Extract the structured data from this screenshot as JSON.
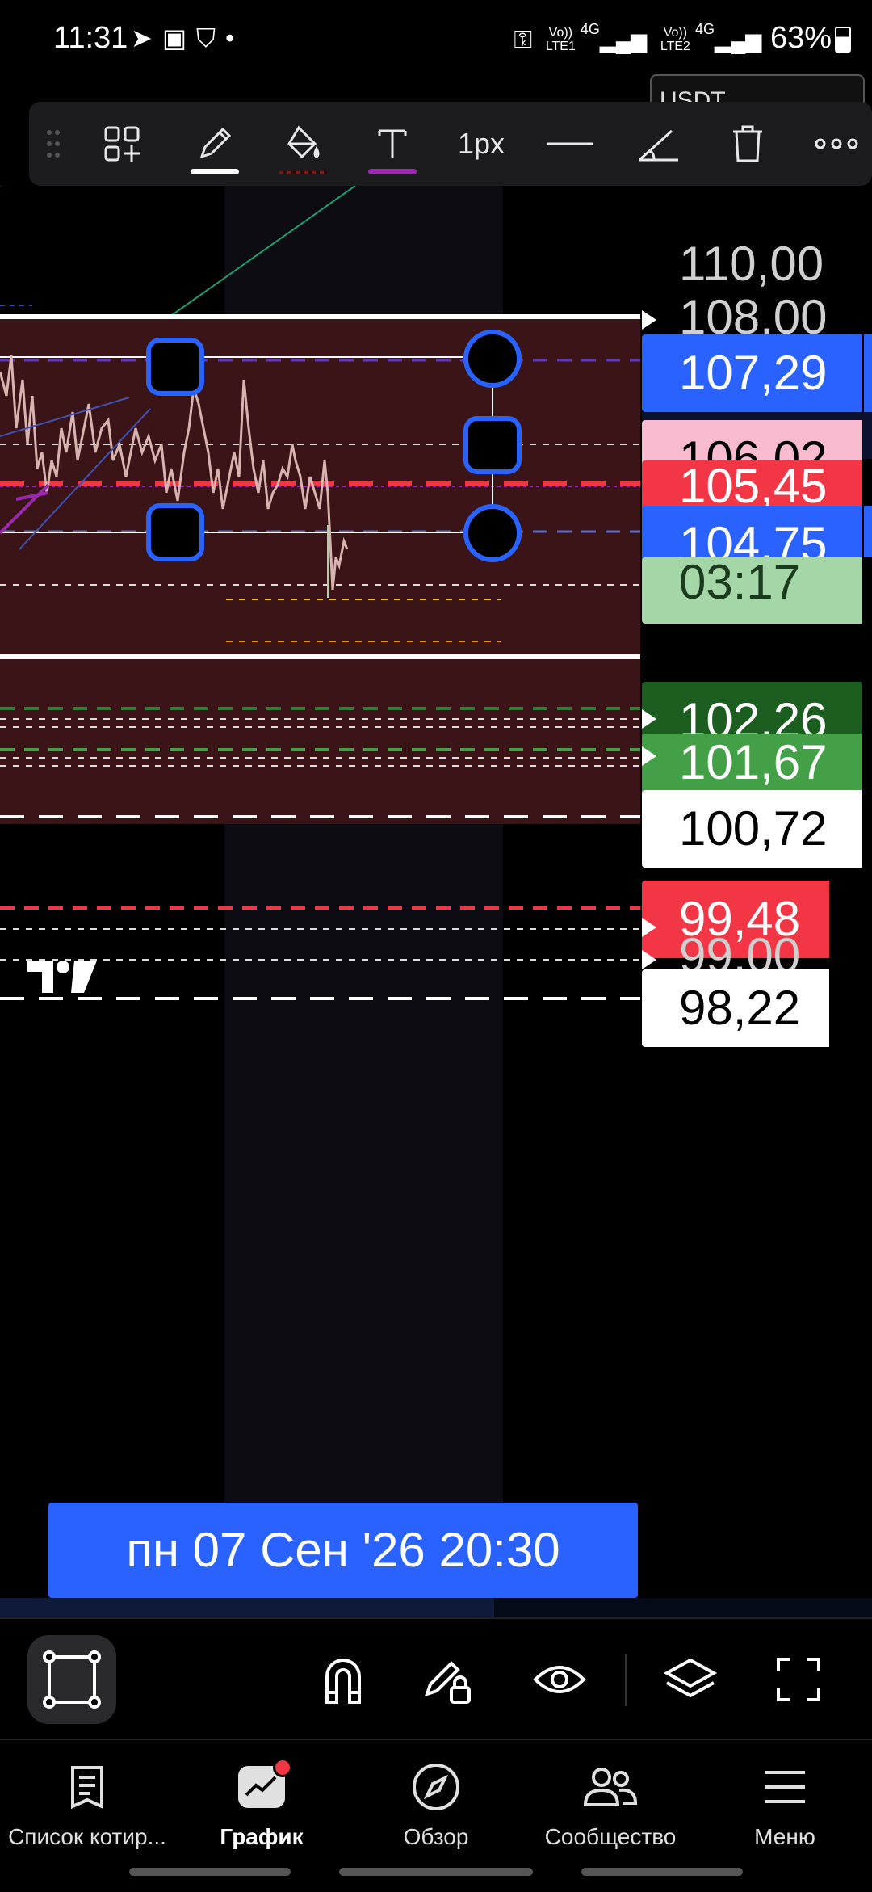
{
  "status_bar": {
    "time": "11:31",
    "battery": "63%",
    "sim1": {
      "top": "Vo))",
      "bottom": "LTE1",
      "tech": "4G"
    },
    "sim2": {
      "top": "Vo))",
      "bottom": "LTE2",
      "tech": "4G"
    }
  },
  "symbol_chip": "USDT",
  "toolbar": {
    "stroke_width": "1px",
    "icons": [
      "drag-handle-icon",
      "add-widgets-icon",
      "pencil-icon",
      "fill-bucket-icon",
      "text-icon",
      "line-style-icon",
      "angle-icon",
      "trash-icon",
      "more-icon"
    ],
    "pencil_underline_color": "#ffffff",
    "text_underline_color": "#9c27b0"
  },
  "price_scale": {
    "plain_labels": [
      "110,00",
      "108,00",
      "99,00"
    ],
    "tags": [
      {
        "value": "107,29",
        "bg": "#2962ff",
        "fg": "#ffffff"
      },
      {
        "value": "106,02",
        "bg": "#f8bbd0",
        "fg": "#000000"
      },
      {
        "value": "105,45",
        "bg": "#f23645",
        "fg": "#ffffff"
      },
      {
        "value": "104,75",
        "bg": "#2962ff",
        "fg": "#ffffff"
      },
      {
        "value": "03:17",
        "bg": "#a5d6a7",
        "fg": "#1b3a1e"
      },
      {
        "value": "102,26",
        "bg": "#1b5e20",
        "fg": "#ffffff"
      },
      {
        "value": "101,67",
        "bg": "#43a047",
        "fg": "#ffffff"
      },
      {
        "value": "100,72",
        "bg": "#ffffff",
        "fg": "#000000"
      },
      {
        "value": "99,48",
        "bg": "#f23645",
        "fg": "#ffffff"
      },
      {
        "value": "98,22",
        "bg": "#ffffff",
        "fg": "#000000"
      }
    ]
  },
  "crosshair_date": "пн 07 Сен '26   20:30",
  "bottom_tools": {
    "icons": [
      "rectangle-tool-icon",
      "magnet-icon",
      "lock-drawing-icon",
      "eye-icon",
      "layers-icon",
      "fullscreen-icon"
    ]
  },
  "bottom_nav": {
    "items": [
      {
        "label": "Список котир...",
        "icon": "watchlist-icon"
      },
      {
        "label": "График",
        "icon": "chart-icon",
        "active": true,
        "badge": true
      },
      {
        "label": "Обзор",
        "icon": "compass-icon"
      },
      {
        "label": "Сообщество",
        "icon": "community-icon"
      },
      {
        "label": "Меню",
        "icon": "menu-icon"
      }
    ]
  },
  "colors": {
    "accent_blue": "#2962ff",
    "selection_fill": "#3a1416",
    "notification_red": "#f23645"
  }
}
